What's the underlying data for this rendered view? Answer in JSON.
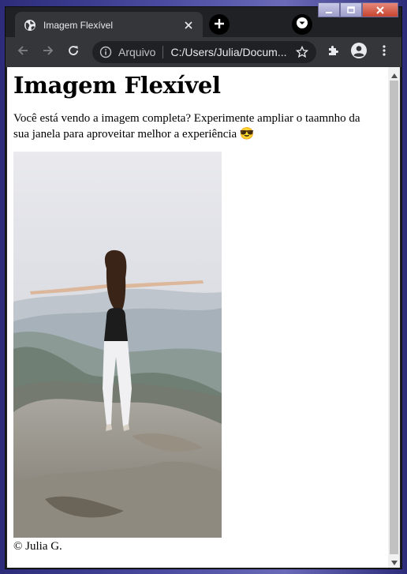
{
  "browser": {
    "tab": {
      "title": "Imagem Flexível",
      "favicon": "globe-icon",
      "close_icon": "close-icon"
    },
    "new_tab_icon": "plus-icon",
    "tab_search_icon": "chevron-down-icon",
    "window_controls": [
      "minimize-icon",
      "maximize-icon",
      "close-icon"
    ],
    "toolbar": {
      "back_icon": "back-arrow-icon",
      "forward_icon": "forward-arrow-icon",
      "reload_icon": "reload-icon",
      "extensions_icon": "puzzle-icon",
      "profile_icon": "avatar-icon",
      "menu_icon": "kebab-menu-icon"
    },
    "omnibox": {
      "info_icon": "info-icon",
      "scheme_label": "Arquivo",
      "url": "C:/Users/Julia/Docum...",
      "bookmark_icon": "star-icon"
    }
  },
  "page": {
    "title": "Imagem Flexível",
    "paragraph": "Você está vendo a imagem completa? Experimente ampliar o taamnho da sua janela para aproveitar melhor a experiência 😎",
    "image_alt": "woman with outstretched arms on a mountain top",
    "footer": "© Julia G."
  },
  "colors": {
    "tab_strip": "#202124",
    "toolbar": "#35363a",
    "omnibox": "#202124",
    "page_background": "#ffffff"
  }
}
